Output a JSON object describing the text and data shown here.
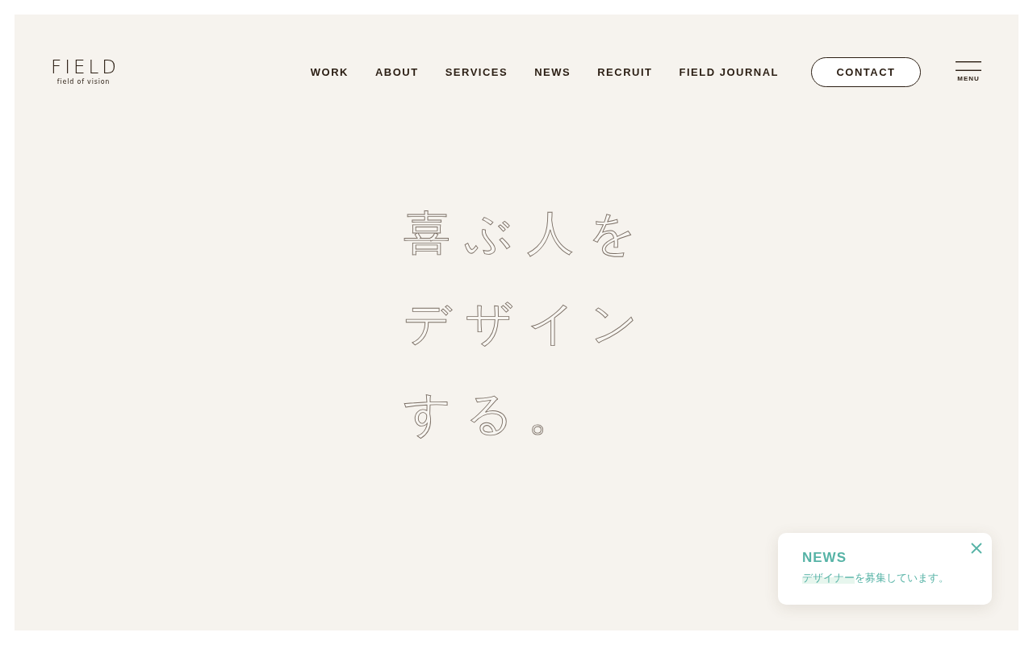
{
  "logo": {
    "wordmark": "FIELD",
    "tagline": "field of vision"
  },
  "nav": {
    "items": [
      "WORK",
      "ABOUT",
      "SERVICES",
      "NEWS",
      "RECRUIT",
      "FIELD JOURNAL"
    ],
    "contact": "CONTACT",
    "menu_label": "MENU"
  },
  "hero": {
    "lines": [
      "喜ぶ人を",
      "デザイン",
      "する。"
    ]
  },
  "news_popup": {
    "title": "NEWS",
    "link": "デザイナー",
    "message_rest": "を募集しています。"
  }
}
